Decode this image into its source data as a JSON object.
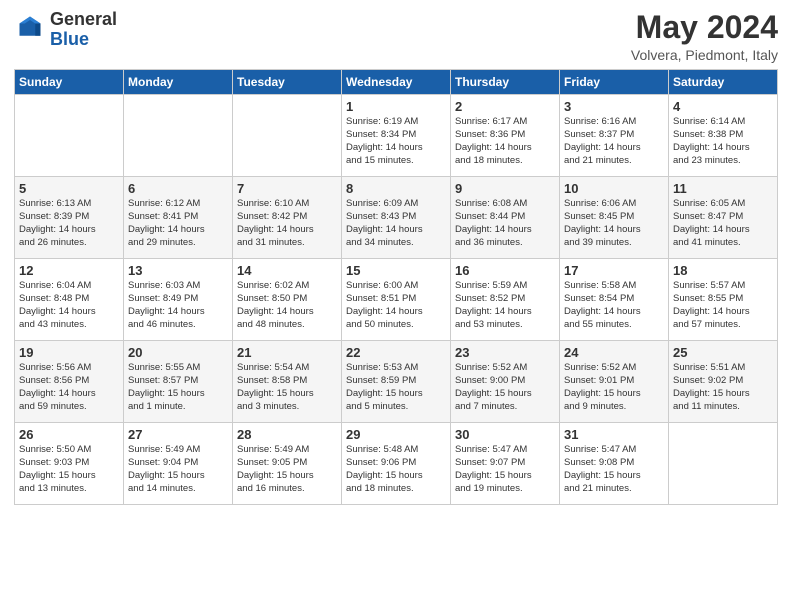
{
  "logo": {
    "general": "General",
    "blue": "Blue"
  },
  "title": {
    "month": "May 2024",
    "location": "Volvera, Piedmont, Italy"
  },
  "weekdays": [
    "Sunday",
    "Monday",
    "Tuesday",
    "Wednesday",
    "Thursday",
    "Friday",
    "Saturday"
  ],
  "weeks": [
    [
      {
        "day": "",
        "info": ""
      },
      {
        "day": "",
        "info": ""
      },
      {
        "day": "",
        "info": ""
      },
      {
        "day": "1",
        "info": "Sunrise: 6:19 AM\nSunset: 8:34 PM\nDaylight: 14 hours\nand 15 minutes."
      },
      {
        "day": "2",
        "info": "Sunrise: 6:17 AM\nSunset: 8:36 PM\nDaylight: 14 hours\nand 18 minutes."
      },
      {
        "day": "3",
        "info": "Sunrise: 6:16 AM\nSunset: 8:37 PM\nDaylight: 14 hours\nand 21 minutes."
      },
      {
        "day": "4",
        "info": "Sunrise: 6:14 AM\nSunset: 8:38 PM\nDaylight: 14 hours\nand 23 minutes."
      }
    ],
    [
      {
        "day": "5",
        "info": "Sunrise: 6:13 AM\nSunset: 8:39 PM\nDaylight: 14 hours\nand 26 minutes."
      },
      {
        "day": "6",
        "info": "Sunrise: 6:12 AM\nSunset: 8:41 PM\nDaylight: 14 hours\nand 29 minutes."
      },
      {
        "day": "7",
        "info": "Sunrise: 6:10 AM\nSunset: 8:42 PM\nDaylight: 14 hours\nand 31 minutes."
      },
      {
        "day": "8",
        "info": "Sunrise: 6:09 AM\nSunset: 8:43 PM\nDaylight: 14 hours\nand 34 minutes."
      },
      {
        "day": "9",
        "info": "Sunrise: 6:08 AM\nSunset: 8:44 PM\nDaylight: 14 hours\nand 36 minutes."
      },
      {
        "day": "10",
        "info": "Sunrise: 6:06 AM\nSunset: 8:45 PM\nDaylight: 14 hours\nand 39 minutes."
      },
      {
        "day": "11",
        "info": "Sunrise: 6:05 AM\nSunset: 8:47 PM\nDaylight: 14 hours\nand 41 minutes."
      }
    ],
    [
      {
        "day": "12",
        "info": "Sunrise: 6:04 AM\nSunset: 8:48 PM\nDaylight: 14 hours\nand 43 minutes."
      },
      {
        "day": "13",
        "info": "Sunrise: 6:03 AM\nSunset: 8:49 PM\nDaylight: 14 hours\nand 46 minutes."
      },
      {
        "day": "14",
        "info": "Sunrise: 6:02 AM\nSunset: 8:50 PM\nDaylight: 14 hours\nand 48 minutes."
      },
      {
        "day": "15",
        "info": "Sunrise: 6:00 AM\nSunset: 8:51 PM\nDaylight: 14 hours\nand 50 minutes."
      },
      {
        "day": "16",
        "info": "Sunrise: 5:59 AM\nSunset: 8:52 PM\nDaylight: 14 hours\nand 53 minutes."
      },
      {
        "day": "17",
        "info": "Sunrise: 5:58 AM\nSunset: 8:54 PM\nDaylight: 14 hours\nand 55 minutes."
      },
      {
        "day": "18",
        "info": "Sunrise: 5:57 AM\nSunset: 8:55 PM\nDaylight: 14 hours\nand 57 minutes."
      }
    ],
    [
      {
        "day": "19",
        "info": "Sunrise: 5:56 AM\nSunset: 8:56 PM\nDaylight: 14 hours\nand 59 minutes."
      },
      {
        "day": "20",
        "info": "Sunrise: 5:55 AM\nSunset: 8:57 PM\nDaylight: 15 hours\nand 1 minute."
      },
      {
        "day": "21",
        "info": "Sunrise: 5:54 AM\nSunset: 8:58 PM\nDaylight: 15 hours\nand 3 minutes."
      },
      {
        "day": "22",
        "info": "Sunrise: 5:53 AM\nSunset: 8:59 PM\nDaylight: 15 hours\nand 5 minutes."
      },
      {
        "day": "23",
        "info": "Sunrise: 5:52 AM\nSunset: 9:00 PM\nDaylight: 15 hours\nand 7 minutes."
      },
      {
        "day": "24",
        "info": "Sunrise: 5:52 AM\nSunset: 9:01 PM\nDaylight: 15 hours\nand 9 minutes."
      },
      {
        "day": "25",
        "info": "Sunrise: 5:51 AM\nSunset: 9:02 PM\nDaylight: 15 hours\nand 11 minutes."
      }
    ],
    [
      {
        "day": "26",
        "info": "Sunrise: 5:50 AM\nSunset: 9:03 PM\nDaylight: 15 hours\nand 13 minutes."
      },
      {
        "day": "27",
        "info": "Sunrise: 5:49 AM\nSunset: 9:04 PM\nDaylight: 15 hours\nand 14 minutes."
      },
      {
        "day": "28",
        "info": "Sunrise: 5:49 AM\nSunset: 9:05 PM\nDaylight: 15 hours\nand 16 minutes."
      },
      {
        "day": "29",
        "info": "Sunrise: 5:48 AM\nSunset: 9:06 PM\nDaylight: 15 hours\nand 18 minutes."
      },
      {
        "day": "30",
        "info": "Sunrise: 5:47 AM\nSunset: 9:07 PM\nDaylight: 15 hours\nand 19 minutes."
      },
      {
        "day": "31",
        "info": "Sunrise: 5:47 AM\nSunset: 9:08 PM\nDaylight: 15 hours\nand 21 minutes."
      },
      {
        "day": "",
        "info": ""
      }
    ]
  ]
}
